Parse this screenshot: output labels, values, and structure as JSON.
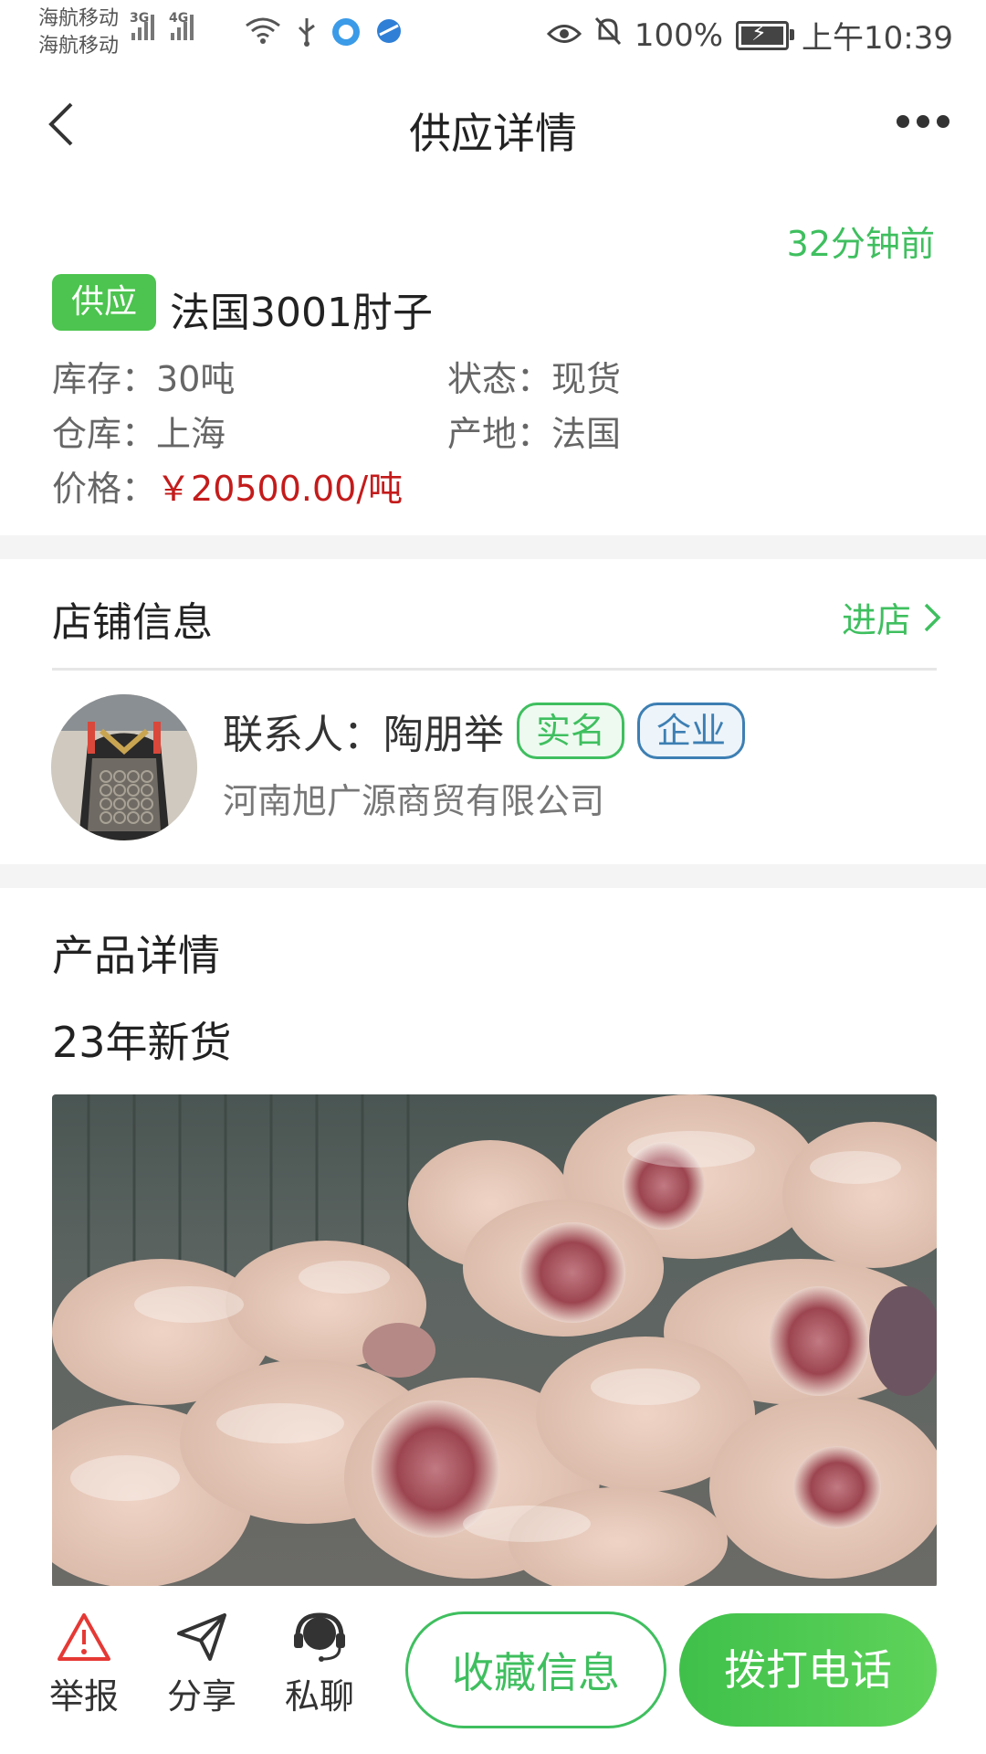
{
  "status_bar": {
    "carrier_1": "海航移动",
    "carrier_2": "海航移动",
    "net_1": "3G",
    "net_2": "4G",
    "battery": "100%",
    "time": "上午10:39"
  },
  "header": {
    "title": "供应详情"
  },
  "supply": {
    "time_ago": "32分钟前",
    "tag": "供应",
    "product_name": "法国3001肘子",
    "stock_label": "库存：",
    "stock_value": "30吨",
    "status_label": "状态：",
    "status_value": "现货",
    "warehouse_label": "仓库：",
    "warehouse_value": "上海",
    "origin_label": "产地：",
    "origin_value": "法国",
    "price_label": "价格：",
    "price_value": "￥20500.00/吨"
  },
  "shop": {
    "title": "店铺信息",
    "enter_label": "进店",
    "contact_label": "联系人：陶朋举",
    "badge_real": "实名",
    "badge_enterprise": "企业",
    "company": "河南旭广源商贸有限公司"
  },
  "product_detail": {
    "title": "产品详情",
    "description": "23年新货"
  },
  "bottom_bar": {
    "report_label": "举报",
    "share_label": "分享",
    "chat_label": "私聊",
    "favorite_label": "收藏信息",
    "call_label": "拨打电话"
  },
  "colors": {
    "accent_green": "#3fbf5f",
    "price_red": "#c41b1b",
    "enterprise_blue": "#3d7fb3",
    "report_red": "#e53935"
  }
}
